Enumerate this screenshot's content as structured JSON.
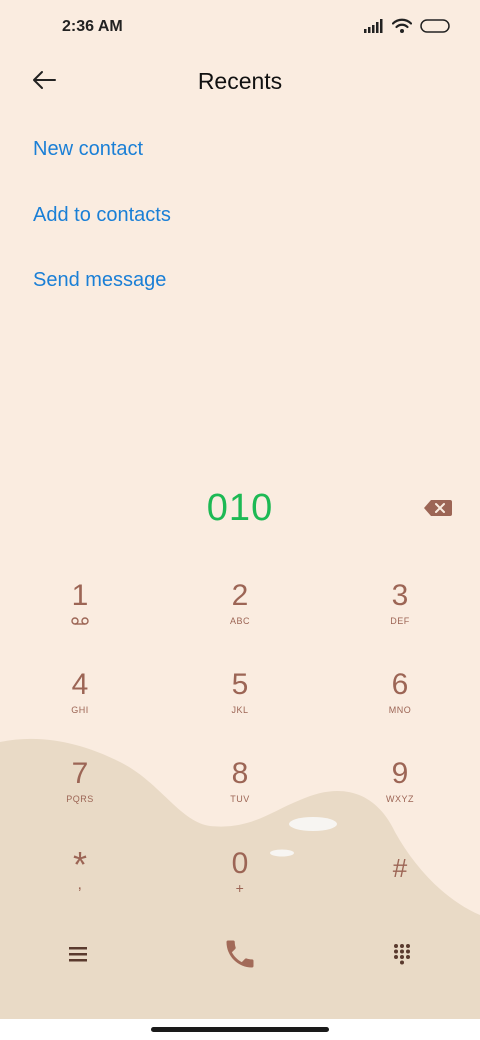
{
  "status_bar": {
    "time": "2:36 AM",
    "icons": [
      "signal-icon",
      "wifi-icon",
      "battery-icon"
    ]
  },
  "header": {
    "title": "Recents",
    "back_icon": "back-arrow-icon"
  },
  "actions": [
    {
      "label": "New contact"
    },
    {
      "label": "Add to contacts"
    },
    {
      "label": "Send message"
    }
  ],
  "dialer": {
    "number": "010",
    "backspace_icon": "backspace-icon"
  },
  "keypad": [
    {
      "digit": "1",
      "letters": ""
    },
    {
      "digit": "2",
      "letters": "ABC"
    },
    {
      "digit": "3",
      "letters": "DEF"
    },
    {
      "digit": "4",
      "letters": "GHI"
    },
    {
      "digit": "5",
      "letters": "JKL"
    },
    {
      "digit": "6",
      "letters": "MNO"
    },
    {
      "digit": "7",
      "letters": "PQRS"
    },
    {
      "digit": "8",
      "letters": "TUV"
    },
    {
      "digit": "9",
      "letters": "WXYZ"
    },
    {
      "digit": "*",
      "letters": ","
    },
    {
      "digit": "0",
      "letters": "+"
    },
    {
      "digit": "#",
      "letters": ""
    }
  ],
  "bottom_bar": {
    "menu_icon": "menu-icon",
    "call_icon": "phone-call-icon",
    "keypad_icon": "dialpad-icon"
  },
  "colors": {
    "background": "#faece0",
    "accent_link": "#1a7fd6",
    "number": "#1db954",
    "key": "#9c6555"
  }
}
